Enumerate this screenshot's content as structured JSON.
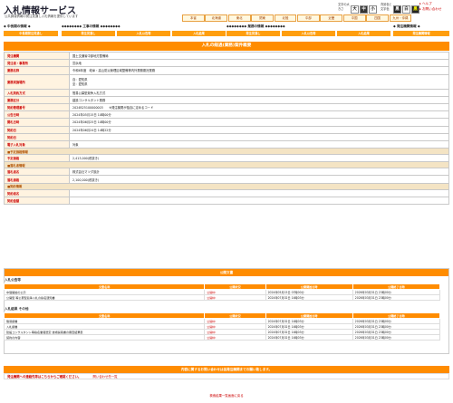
{
  "site": {
    "title": "入札情報サービス",
    "subtitle": "公共調達情報の発注見通し入札情報を提供しています"
  },
  "font_size": {
    "label": "文字の大きさ",
    "buttons": [
      "大",
      "中",
      "小"
    ]
  },
  "color_mode": {
    "label": "背景色と文字色",
    "buttons": [
      "黒",
      "白",
      "黒"
    ]
  },
  "header_links": [
    "ヘルプ",
    "お問い合わせ"
  ],
  "regions": [
    "本省",
    "北海道",
    "東北",
    "関東",
    "北陸",
    "中部",
    "近畿",
    "中国",
    "四国",
    "九州・沖縄"
  ],
  "nav": [
    {
      "title": "◆ 中長期の情報 ◆",
      "buttons": [
        "中長期発注見通し"
      ]
    },
    {
      "title": "◆◆◆◆◆◆◆◆ 工事の情報 ◆◆◆◆◆◆◆◆",
      "buttons": [
        "発注見通し",
        "入札公告等",
        "入札結果"
      ]
    },
    {
      "title": "◆◆◆◆◆◆◆◆ 業務の情報 ◆◆◆◆◆◆◆◆",
      "buttons": [
        "発注見通し",
        "入札公告等",
        "入札結果"
      ]
    },
    {
      "title": "◆ 発注機関情報 ◆",
      "buttons": [
        "発注機関情報"
      ]
    }
  ],
  "main_title": "入札の経過(業務)案件概要",
  "details": [
    {
      "k": "発注機関",
      "v": "国土交通省中部地方整備局"
    },
    {
      "k": "発注者・事務所",
      "v": "富浜地"
    },
    {
      "k": "業務名称",
      "v": "令和6年度　岐阜・高山防災管理区域整備等内外業務委託業務"
    },
    {
      "k": "業務実施場所",
      "v": "自：愛知県\n至：愛知県",
      "tall": true
    },
    {
      "k": "入札契約方式",
      "v": "簡易公募型競争入札方式"
    },
    {
      "k": "業務区分",
      "v": "建設コンサルタント業務"
    },
    {
      "k": "契約管理番号",
      "v": "2024B25100000003　　※発注機関が独自に定めるコード"
    },
    {
      "k": "公告日時",
      "v": "2024年05月15日 10時00分"
    },
    {
      "k": "開札日時",
      "v": "2024年06月25日 10時00分"
    },
    {
      "k": "契約日",
      "v": "2024年06月24日 14時22分"
    },
    {
      "k": "契約日",
      "v": ""
    },
    {
      "k": "電子入札対象",
      "v": "対象"
    },
    {
      "section": "■予定価格情報"
    },
    {
      "k": "予定価格",
      "v": "2,413,000(税抜き)"
    },
    {
      "section": "■落札者情報"
    },
    {
      "k": "落札者名",
      "v": "株式会社マツダ設計"
    },
    {
      "k": "落札価格",
      "v": "2,100,000(税抜き)"
    },
    {
      "section": "■契約情報"
    },
    {
      "k": "契約者名",
      "v": ""
    },
    {
      "k": "契約金額",
      "v": ""
    }
  ],
  "docs": {
    "bar": "公開文書",
    "group1": {
      "title": "入札公告等",
      "headers": [
        "文書名称",
        "公開状況",
        "公開開始日時",
        "公開終了日時"
      ],
      "rows": [
        [
          "中間開始の公示",
          "公開中",
          "2024年05月15日 07時00分",
          "2026年03月31日 23時00分"
        ],
        [
          "公開型 等公募型競争入札の指名通知書",
          "公開中",
          "2024年07月02日 14時03分",
          "2026年03月31日 23時00分"
        ]
      ]
    },
    "group2": {
      "title": "入札結果 その他",
      "headers": [
        "文書名称",
        "公開状況",
        "公開開始日時",
        "公開終了日時"
      ],
      "rows": [
        [
          "簡易調書",
          "公開中",
          "2024年07月02日 14時03分",
          "2026年03月31日 23時00分"
        ],
        [
          "入札調書",
          "公開中",
          "2024年07月02日 14時03分",
          "2026年03月31日 23時00分"
        ],
        [
          "建設コンサルタント等指名業者選定 技術提案書の審査結果表",
          "公開中",
          "2024年07月02日 14時03分",
          "2026年03月31日 23時00分"
        ],
        [
          "契約の内容",
          "公開中",
          "2024年07月02日 14時03分",
          "2026年03月31日 23時00分"
        ]
      ]
    }
  },
  "contact": {
    "bar": "内容に関するお問い合わせは各発注機関までお願い致します。",
    "label": "発注機関への連絡先等はこちらからご確認ください。",
    "link": "問い合わせ先一覧"
  },
  "back_link": "検索結果一覧画面に戻る"
}
